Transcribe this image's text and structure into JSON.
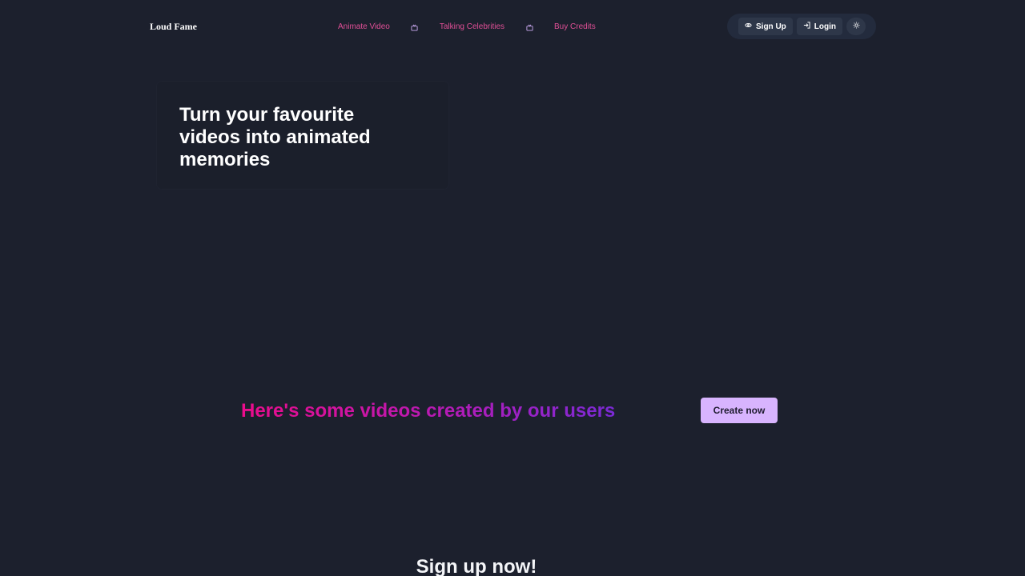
{
  "header": {
    "brand": "Loud Fame",
    "nav": [
      {
        "label": "Animate Video"
      },
      {
        "label": "Talking Celebrities"
      },
      {
        "label": "Buy Credits"
      }
    ],
    "actions": {
      "signup_label": "Sign Up",
      "login_label": "Login"
    }
  },
  "hero": {
    "title": "Turn your favourite videos into animated memories"
  },
  "showcase": {
    "title": "Here's some videos created by our users",
    "cta_label": "Create now"
  },
  "signup": {
    "title": "Sign up now!"
  },
  "colors": {
    "background": "#1c202d",
    "nav_link": "#e04f96",
    "gradient_start": "#ec0c8c",
    "gradient_end": "#7b2ad6",
    "cta_bg": "#d8b4fe"
  },
  "icons": [
    "tv-icon",
    "user-plus-icon",
    "login-icon",
    "sun-icon"
  ]
}
